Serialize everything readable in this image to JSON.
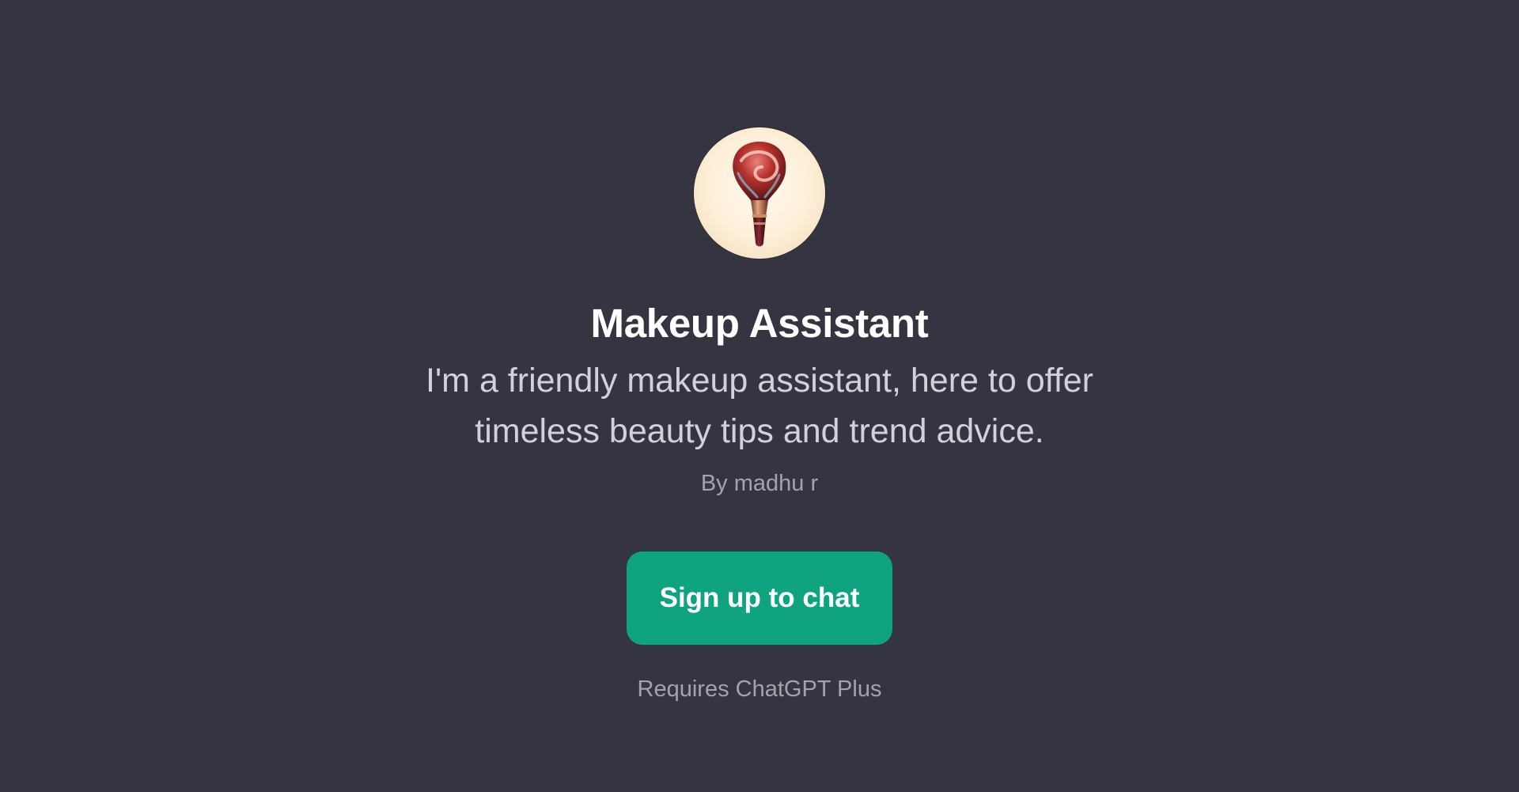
{
  "gpt": {
    "avatar_icon": "makeup-brush-icon",
    "title": "Makeup Assistant",
    "description": "I'm a friendly makeup assistant, here to offer timeless beauty tips and trend advice.",
    "author": "By madhu r"
  },
  "actions": {
    "signup_label": "Sign up to chat",
    "requirement_note": "Requires ChatGPT Plus"
  },
  "colors": {
    "background": "#343541",
    "accent": "#10a37f",
    "title": "#ffffff",
    "description": "#d1d1db",
    "muted": "#a3a3ad"
  }
}
